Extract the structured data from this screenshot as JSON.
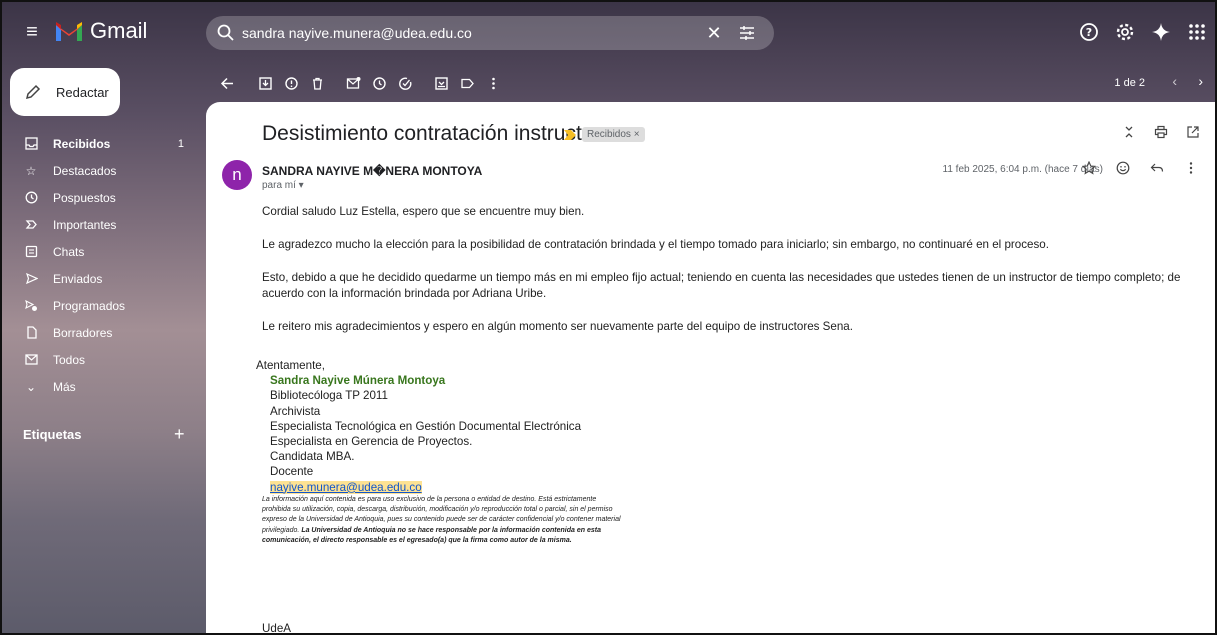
{
  "header": {
    "app_name": "Gmail",
    "search_value": "sandra nayive.munera@udea.edu.co"
  },
  "sidebar": {
    "compose_label": "Redactar",
    "items": [
      {
        "label": "Recibidos",
        "count": "1",
        "icon": "inbox-icon"
      },
      {
        "label": "Destacados",
        "icon": "star-icon"
      },
      {
        "label": "Pospuestos",
        "icon": "clock-icon"
      },
      {
        "label": "Importantes",
        "icon": "important-icon"
      },
      {
        "label": "Chats",
        "icon": "chat-icon"
      },
      {
        "label": "Enviados",
        "icon": "send-icon"
      },
      {
        "label": "Programados",
        "icon": "scheduled-icon"
      },
      {
        "label": "Borradores",
        "icon": "draft-icon"
      },
      {
        "label": "Todos",
        "icon": "all-mail-icon"
      },
      {
        "label": "Más",
        "icon": "chevron-down-icon"
      }
    ],
    "labels_title": "Etiquetas"
  },
  "toolbar": {
    "pager": "1 de 2"
  },
  "message": {
    "subject": "Desistimiento contratación instructor",
    "label_chip": "Recibidos ×",
    "avatar_letter": "n",
    "sender": "SANDRA NAYIVE M�NERA MONTOYA",
    "to": "para mí ▾",
    "date": "11 feb 2025, 6:04 p.m. (hace 7 días)",
    "paragraphs": [
      "Cordial saludo Luz Estella, espero que se encuentre muy bien.",
      "Le agradezco mucho la elección para la posibilidad de contratación brindada y el tiempo tomado para iniciarlo; sin embargo, no continuaré en el proceso.",
      "Esto, debido a que he decidido quedarme un tiempo más en mi empleo fijo actual; teniendo en cuenta las necesidades que ustedes tienen de un instructor de tiempo completo; de acuerdo con la información brindada por Adriana Uribe.",
      "Le reitero mis agradecimientos y espero en algún momento ser nuevamente parte del equipo de instructores Sena."
    ],
    "signature": {
      "closing": "Atentamente,",
      "name": "Sandra Nayive Múnera Montoya",
      "lines": [
        "Bibliotecóloga TP 2011",
        "Archivista",
        "Especialista Tecnológica en Gestión Documental Electrónica",
        "Especialista en Gerencia de Proyectos.",
        "Candidata MBA.",
        "Docente"
      ],
      "email": "nayive.munera@udea.edu.co"
    },
    "disclaimer_plain": "La información aquí contenida es para uso exclusivo de la persona o entidad de destino. Está estrictamente prohibida su utilización, copia, descarga, distribución, modificación y/o reproducción total o parcial, sin el permiso expreso de la Universidad de Antioquia, pues su contenido puede ser de carácter confidencial y/o contener material privilegiado.",
    "disclaimer_bold": "La Universidad de Antioquia no se hace responsable por la información contenida en esta comunicación, el directo responsable es el egresado(a) que la firma como autor de la misma.",
    "footer_text": "UdeA"
  }
}
